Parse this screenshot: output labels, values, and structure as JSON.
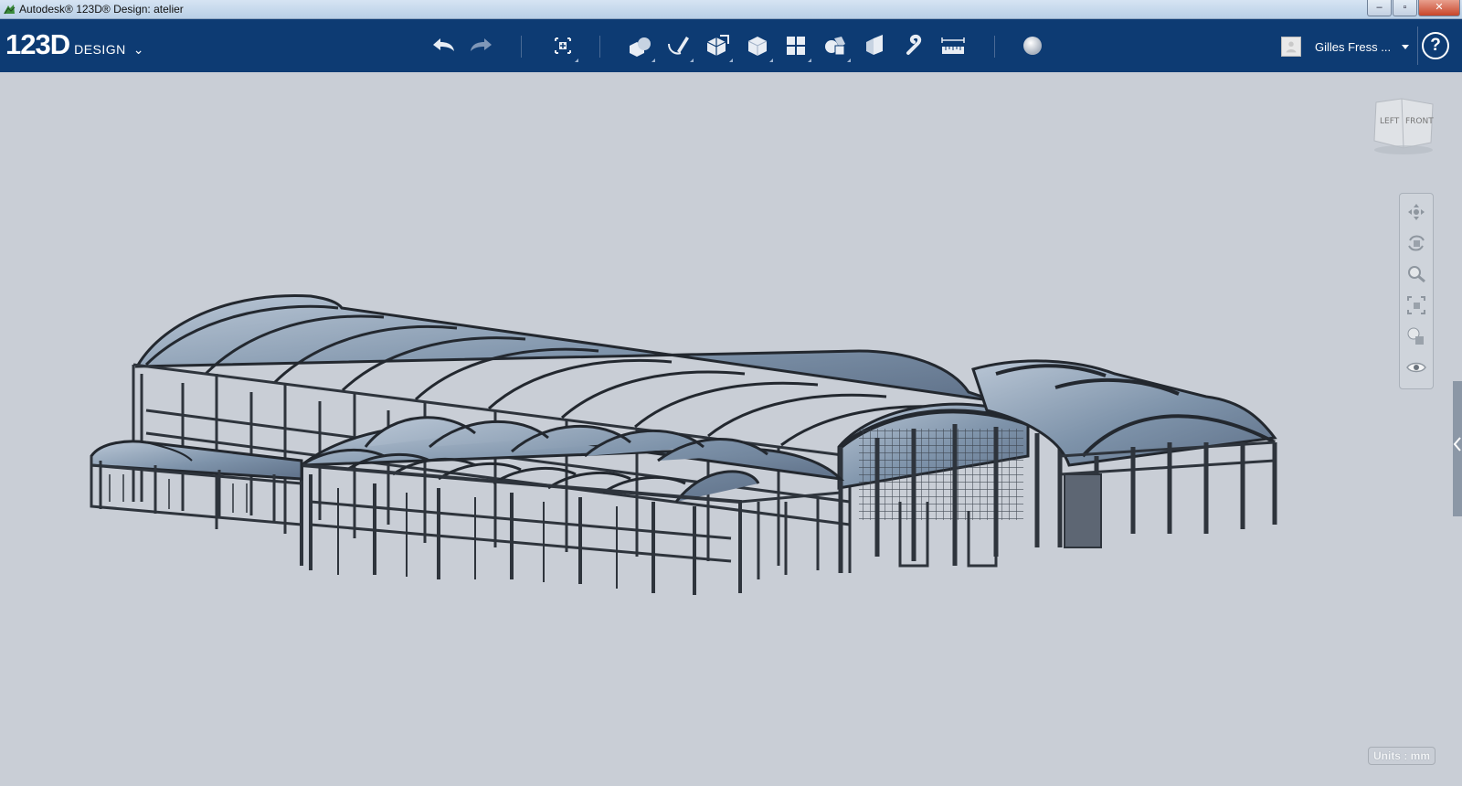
{
  "window": {
    "title": "Autodesk® 123D® Design: atelier",
    "minimize": "–",
    "maximize": "▫",
    "close": "✕"
  },
  "app": {
    "logo_main": "123D",
    "logo_sub": "DESIGN",
    "logo_chevron": "⌄"
  },
  "toolbar": {
    "tools": [
      {
        "name": "undo-icon"
      },
      {
        "name": "redo-icon"
      },
      {
        "name": "transform-icon"
      },
      {
        "name": "primitives-icon"
      },
      {
        "name": "sketch-icon"
      },
      {
        "name": "construct-icon"
      },
      {
        "name": "modify-icon"
      },
      {
        "name": "pattern-icon"
      },
      {
        "name": "grouping-icon"
      },
      {
        "name": "combine-icon"
      },
      {
        "name": "snap-icon"
      },
      {
        "name": "measure-icon"
      },
      {
        "name": "material-icon"
      }
    ]
  },
  "user": {
    "name": "Gilles Fress ..."
  },
  "help": {
    "label": "?"
  },
  "viewcube": {
    "left": "LEFT",
    "front": "FRONT"
  },
  "navbar": {
    "items": [
      "pan-icon",
      "orbit-icon",
      "zoom-icon",
      "fit-icon",
      "visual-style-icon",
      "visibility-icon"
    ]
  },
  "status": {
    "units": "Units : mm"
  },
  "colors": {
    "appbar": "#0d3b73",
    "viewport": "#c9ced6",
    "roof": "#8fa3b9",
    "frame": "#3f4650"
  }
}
